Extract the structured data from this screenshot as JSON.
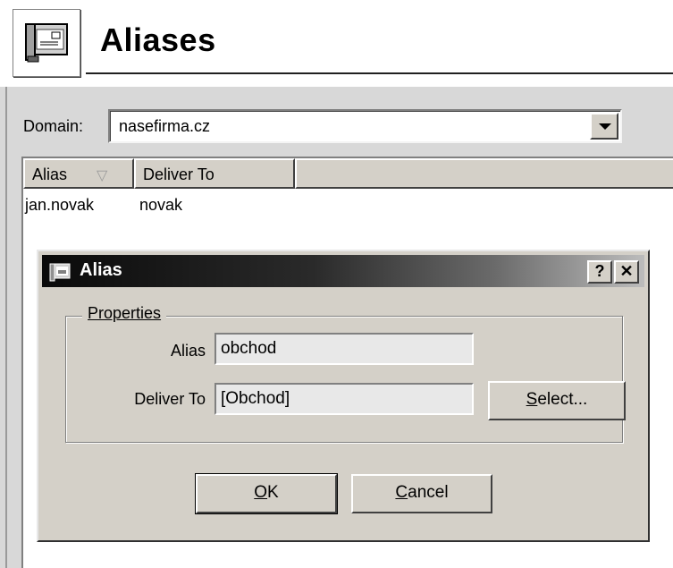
{
  "header": {
    "title": "Aliases",
    "icon": "mail-server-icon"
  },
  "domain": {
    "label": "Domain:",
    "value": "nasefirma.cz"
  },
  "list": {
    "columns": [
      "Alias",
      "Deliver To"
    ],
    "sort_icon": "sort-descending-icon",
    "rows": [
      {
        "alias": "jan.novak",
        "deliver_to": "novak"
      }
    ]
  },
  "dialog": {
    "title": "Alias",
    "help_button": "?",
    "close_button": "✕",
    "group_label": "Properties",
    "alias_label": "Alias",
    "alias_value": "obchod",
    "deliver_to_label": "Deliver To",
    "deliver_to_value": "[Obchod]",
    "select_button": {
      "first": "S",
      "rest": "elect..."
    },
    "ok_button": {
      "first": "O",
      "rest": "K"
    },
    "cancel_button": {
      "first": "C",
      "rest": "ancel"
    }
  },
  "colors": {
    "window_bg": "#d4d0c8",
    "titlebar_start": "#0a0a0a",
    "titlebar_end": "#bcbcbc"
  }
}
